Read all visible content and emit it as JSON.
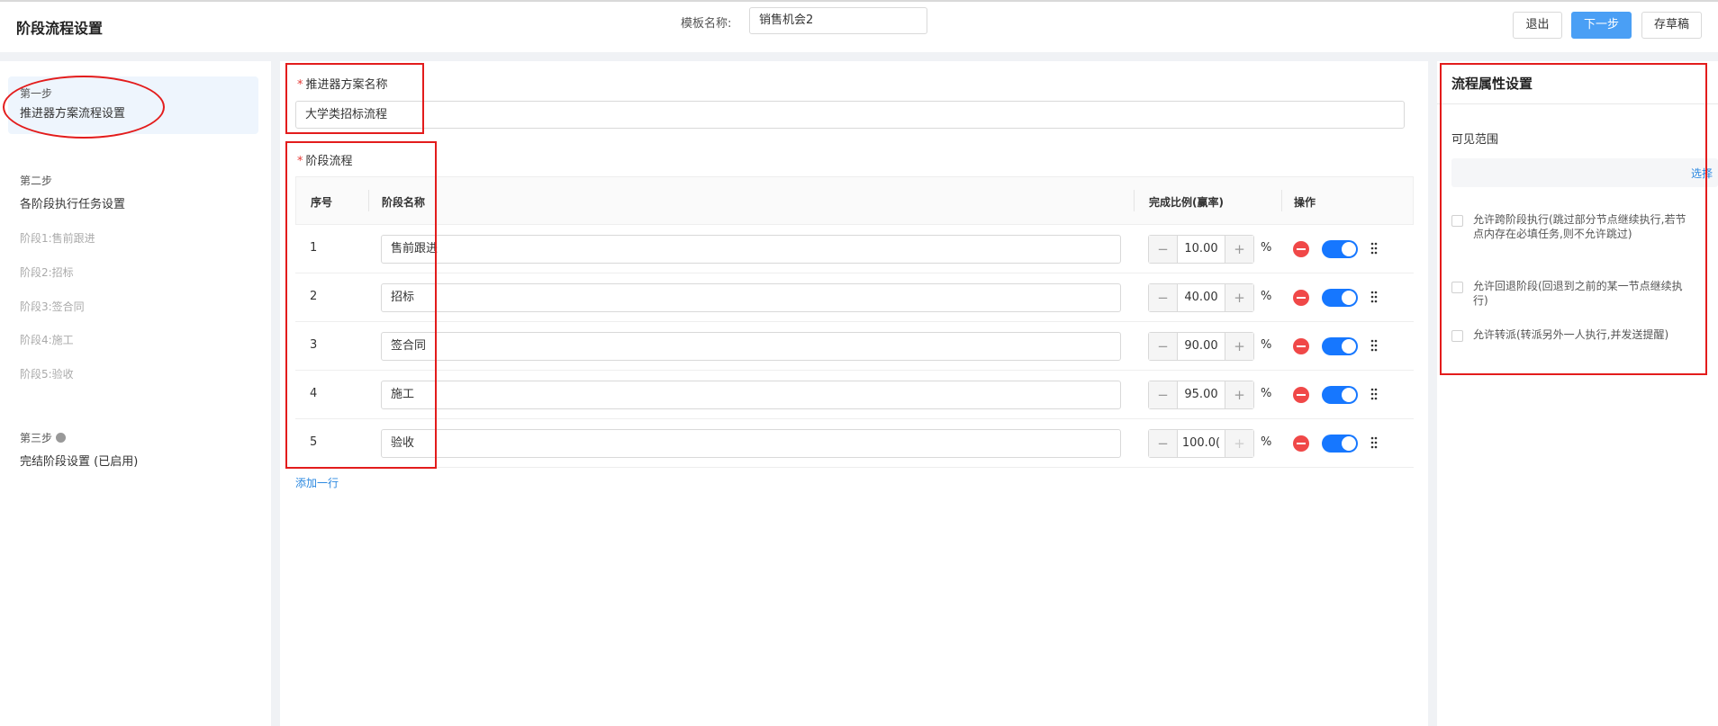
{
  "header": {
    "title": "阶段流程设置",
    "template_label": "模板名称:",
    "template_value": "销售机会2",
    "exit_label": "退出",
    "next_label": "下一步",
    "draft_label": "存草稿"
  },
  "steps": {
    "step1": {
      "label": "第一步",
      "title": "推进器方案流程设置"
    },
    "step2": {
      "label": "第二步",
      "title": "各阶段执行任务设置",
      "stages": [
        "阶段1:售前跟进",
        "阶段2:招标",
        "阶段3:签合同",
        "阶段4:施工",
        "阶段5:验收"
      ]
    },
    "step3": {
      "label": "第三步",
      "title": "完结阶段设置 (已启用)"
    }
  },
  "main": {
    "plan_name_label": "推进器方案名称",
    "plan_name_value": "大学类招标流程",
    "stage_flow_label": "阶段流程",
    "columns": {
      "no": "序号",
      "name": "阶段名称",
      "ratio": "完成比例(赢率)",
      "ops": "操作"
    },
    "percent_sign": "%",
    "rows": [
      {
        "no": "1",
        "name": "售前跟进",
        "ratio": "10.00"
      },
      {
        "no": "2",
        "name": "招标",
        "ratio": "40.00"
      },
      {
        "no": "3",
        "name": "签合同",
        "ratio": "90.00"
      },
      {
        "no": "4",
        "name": "施工",
        "ratio": "95.00"
      },
      {
        "no": "5",
        "name": "验收",
        "ratio": "100.0("
      }
    ],
    "add_row_label": "添加一行"
  },
  "properties": {
    "title": "流程属性设置",
    "visible_range_label": "可见范围",
    "select_label": "选择",
    "options": [
      "允许跨阶段执行(跳过部分节点继续执行,若节点内存在必填任务,则不允许跳过)",
      "允许回退阶段(回退到之前的某一节点继续执行)",
      "允许转派(转派另外一人执行,并发送提醒)"
    ]
  },
  "colors": {
    "primary": "#4a9ff5",
    "toggle_on": "#1677ff",
    "delete": "#f04848",
    "annotation": "#e31c1c",
    "link": "#2b88e0"
  }
}
